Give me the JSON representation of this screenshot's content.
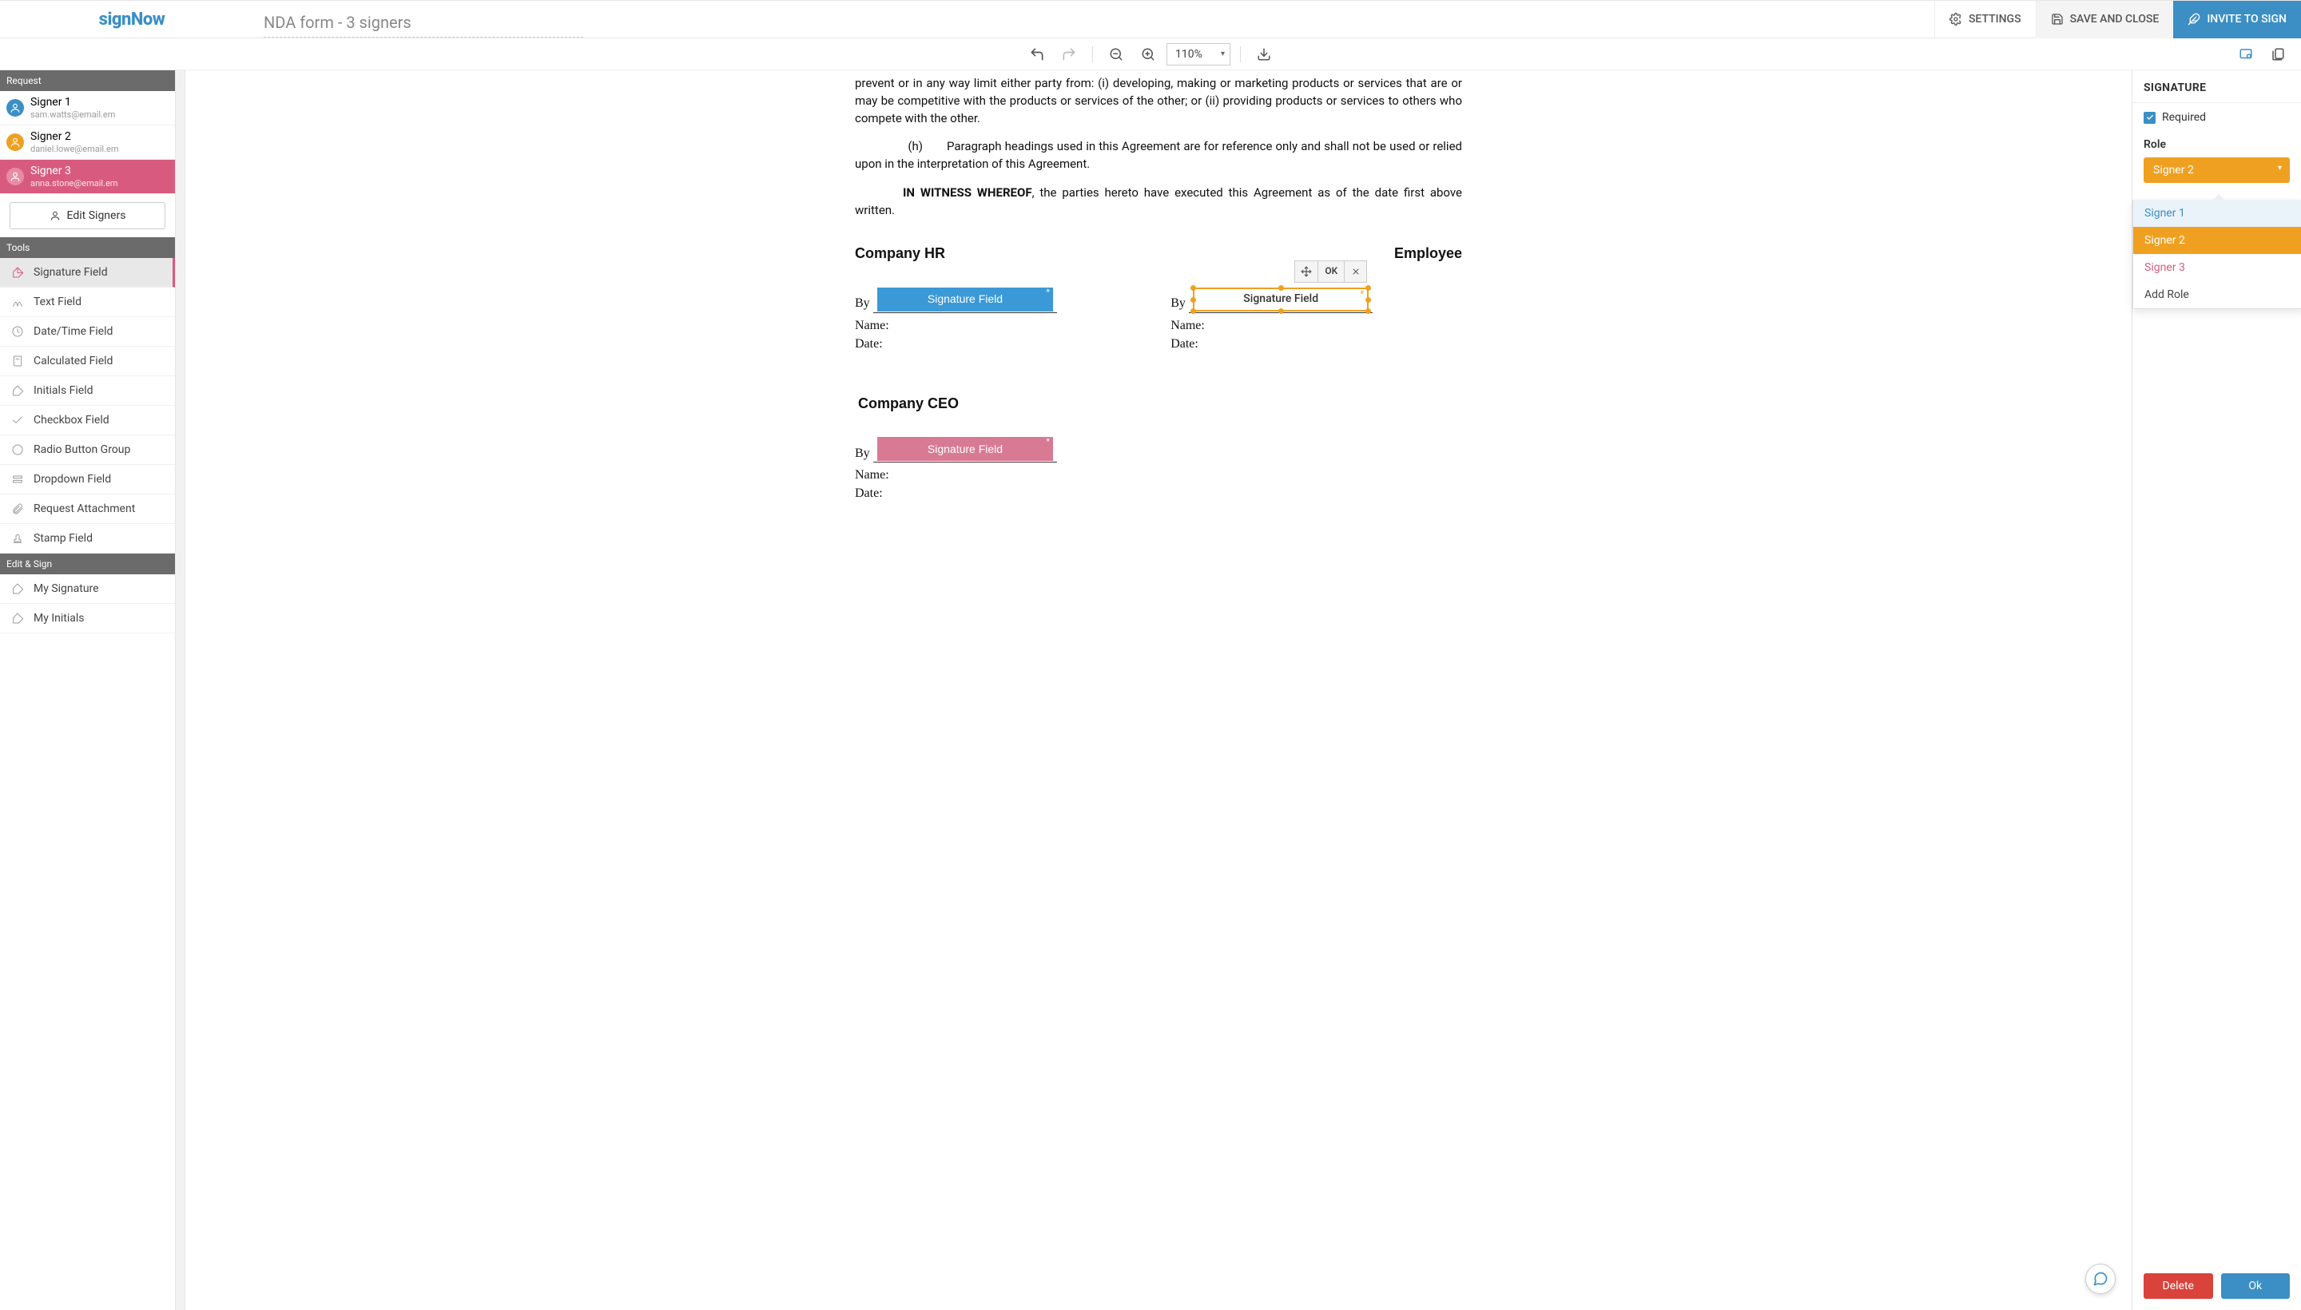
{
  "brand": "signNow",
  "docTitle": "NDA form - 3 signers",
  "topbar": {
    "settings": "SETTINGS",
    "saveClose": "SAVE AND CLOSE",
    "invite": "INVITE TO SIGN"
  },
  "toolbar": {
    "zoom": "110%"
  },
  "leftPanel": {
    "requestHeader": "Request",
    "signers": [
      {
        "name": "Signer 1",
        "email": "sam.watts@email.em",
        "color": "#3b8fc5",
        "active": false
      },
      {
        "name": "Signer 2",
        "email": "daniel.lowe@email.em",
        "color": "#f0a020",
        "active": false
      },
      {
        "name": "Signer 3",
        "email": "anna.stone@email.em",
        "color": "#d85b7f",
        "active": true
      }
    ],
    "editSigners": "Edit Signers",
    "toolsHeader": "Tools",
    "tools": [
      {
        "label": "Signature Field",
        "active": true,
        "icon": "signature"
      },
      {
        "label": "Text Field",
        "icon": "text"
      },
      {
        "label": "Date/Time Field",
        "icon": "clock"
      },
      {
        "label": "Calculated Field",
        "icon": "calc"
      },
      {
        "label": "Initials Field",
        "icon": "initials"
      },
      {
        "label": "Checkbox Field",
        "icon": "check"
      },
      {
        "label": "Radio Button Group",
        "icon": "radio"
      },
      {
        "label": "Dropdown Field",
        "icon": "dropdown"
      },
      {
        "label": "Request Attachment",
        "icon": "attach"
      },
      {
        "label": "Stamp Field",
        "icon": "stamp"
      }
    ],
    "editSignHeader": "Edit & Sign",
    "editSign": [
      {
        "label": "My Signature",
        "icon": "signature"
      },
      {
        "label": "My Initials",
        "icon": "initials"
      }
    ]
  },
  "document": {
    "p1": "prevent or in any way limit either party from: (i) developing, making or marketing products or services that are or may be competitive with the products or services of the other; or (ii) providing products or services to others who compete with the other.",
    "p2_prefix": "(h)",
    "p2": "Paragraph headings used in this Agreement are for reference only and shall not be used or relied upon in the interpretation of this Agreement.",
    "witnessBold": "IN WITNESS WHEREOF",
    "witnessRest": ", the parties hereto have executed this Agreement as of the date first above written.",
    "companyHR": "Company HR",
    "employee": "Employee",
    "companyCEO": "Company CEO",
    "by": "By",
    "name": "Name:",
    "date": "Date:",
    "sigField": "Signature Field",
    "selToolbar": {
      "ok": "OK"
    }
  },
  "rightPanel": {
    "title": "SIGNATURE",
    "required": "Required",
    "roleLabel": "Role",
    "roleSelected": "Signer 2",
    "roleOptions": {
      "s1": "Signer 1",
      "s2": "Signer 2",
      "s3": "Signer 3",
      "add": "Add Role"
    },
    "delete": "Delete",
    "ok": "Ok"
  }
}
